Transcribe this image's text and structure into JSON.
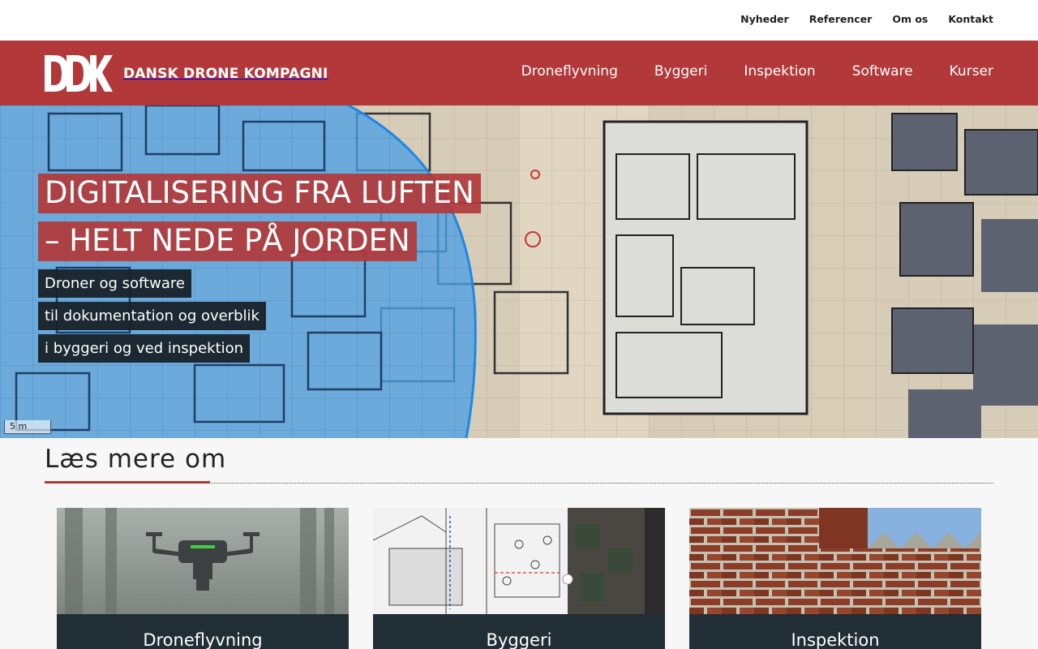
{
  "top_links": [
    "Nyheder",
    "Referencer",
    "Om os",
    "Kontakt"
  ],
  "brand": {
    "logo_mark": "DDK",
    "name": "DANSK DRONE KOMPAGNI"
  },
  "main_nav": [
    "Droneflyvning",
    "Byggeri",
    "Inspektion",
    "Software",
    "Kurser"
  ],
  "hero": {
    "headline": [
      "DIGITALISERING FRA LUFTEN",
      "– HELT NEDE PÅ JORDEN"
    ],
    "sub": [
      "Droner og software",
      "til dokumentation og overblik",
      "i byggeri og ved inspektion"
    ],
    "scale_label": "5 m"
  },
  "read_more": {
    "title": "Læs mere om",
    "cards": [
      {
        "caption": "Droneflyvning",
        "image": "drone-photo"
      },
      {
        "caption": "Byggeri",
        "image": "site-plan-photo"
      },
      {
        "caption": "Inspektion",
        "image": "brick-wall-photo"
      }
    ]
  },
  "colors": {
    "brand_red": "#b2383a",
    "dark": "#222e35"
  }
}
